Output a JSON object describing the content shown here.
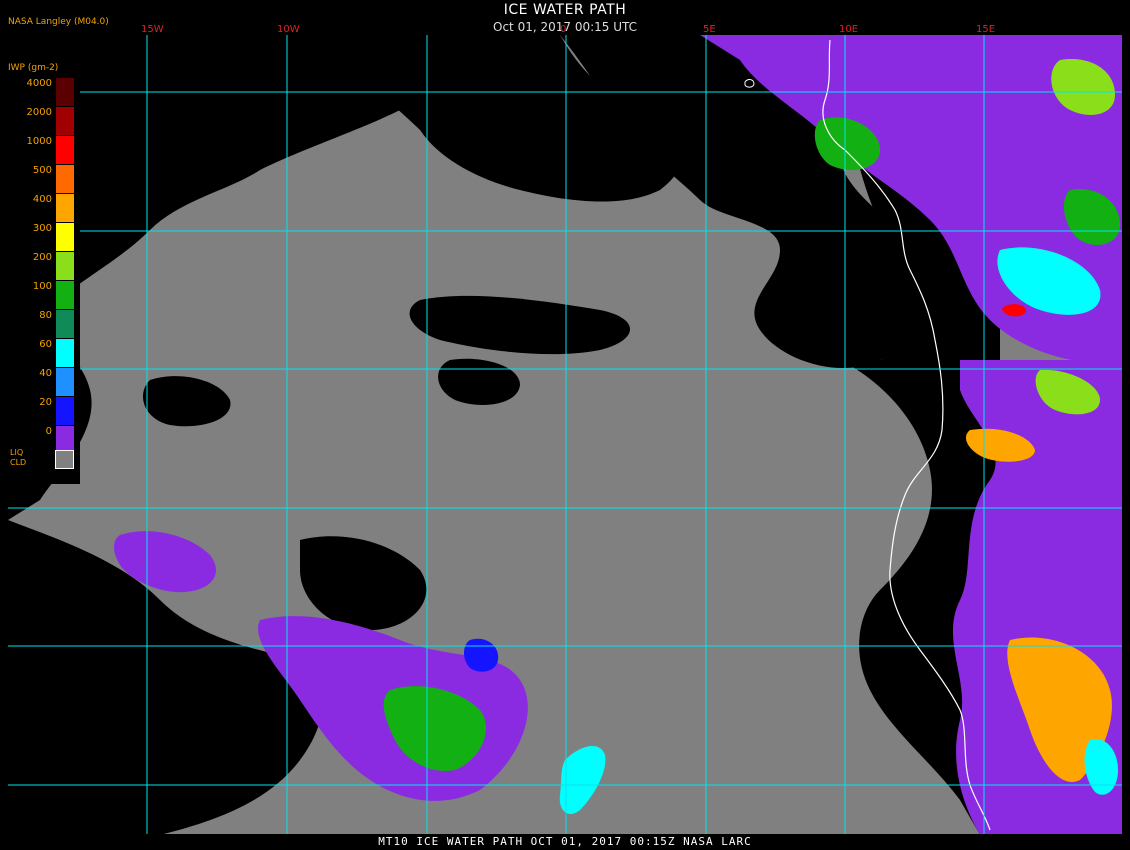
{
  "header": {
    "title": "ICE WATER PATH",
    "subtitle": "Oct 01, 2017 00:15 UTC",
    "org": "NASA Langley (M04.0)"
  },
  "map": {
    "longitude_labels": [
      "15W",
      "10W",
      "0",
      "5E",
      "10E",
      "15E"
    ],
    "latitude_labels": [
      "",
      "",
      "",
      "",
      ""
    ]
  },
  "legend": {
    "units": "IWP (gm-2)",
    "entries": [
      {
        "value": "4000",
        "color": "#5a0000"
      },
      {
        "value": "2000",
        "color": "#a00000"
      },
      {
        "value": "1000",
        "color": "#ff0000"
      },
      {
        "value": "500",
        "color": "#ff6a00"
      },
      {
        "value": "400",
        "color": "#ffa500"
      },
      {
        "value": "300",
        "color": "#ffff00"
      },
      {
        "value": "200",
        "color": "#8adf1a"
      },
      {
        "value": "100",
        "color": "#12b012"
      },
      {
        "value": "80",
        "color": "#118a5a"
      },
      {
        "value": "60",
        "color": "#00ffff"
      },
      {
        "value": "40",
        "color": "#1e90ff"
      },
      {
        "value": "20",
        "color": "#1414ff"
      },
      {
        "value": "0",
        "color": "#8a2be2"
      }
    ],
    "liq_label": "LIQ\nCLD",
    "liq_color": "#808080"
  },
  "footer": {
    "text": "MT10  ICE WATER PATH  OCT 01, 2017 00:15Z  NASA LARC"
  },
  "colors": {
    "grid": "#00e5ee",
    "cloud_gray": "#808080",
    "clear": "#000000",
    "coast": "#ffffff",
    "label": "#f3a200"
  }
}
